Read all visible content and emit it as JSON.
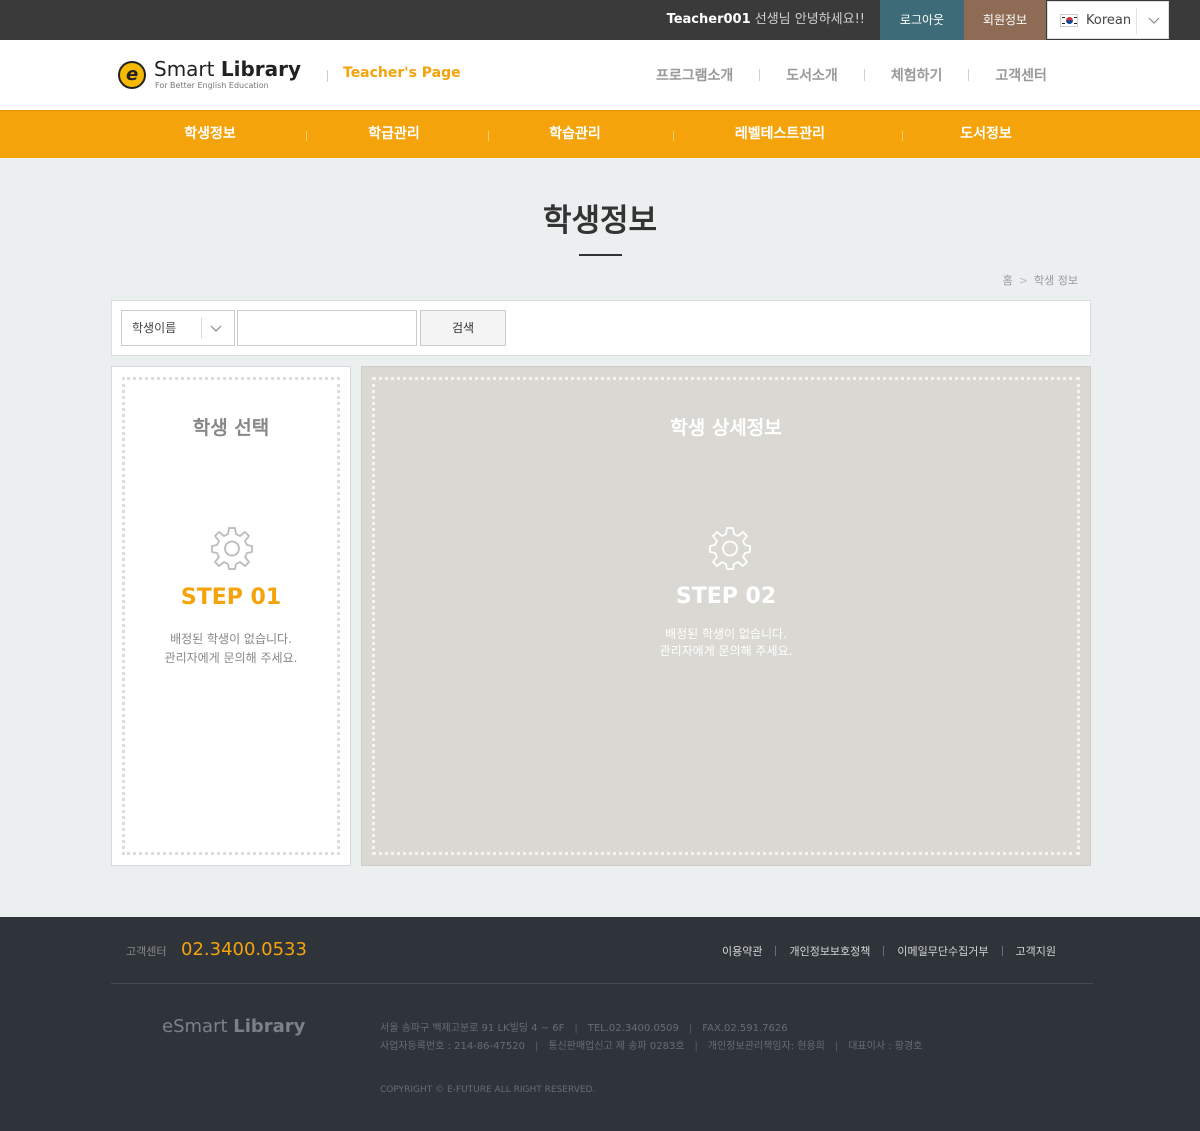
{
  "topbar": {
    "user_id": "Teacher001",
    "greeting_suffix": " 선생님 안녕하세요!!",
    "logout_label": "로그아웃",
    "member_info_label": "회원정보",
    "language": "Korean"
  },
  "header": {
    "logo_text_light": "Smart ",
    "logo_text_bold": "Library",
    "logo_mark": "e",
    "logo_tagline": "For Better English Education",
    "section_label": "Teacher's Page",
    "gnb": [
      "프로그램소개",
      "도서소개",
      "체험하기",
      "고객센터"
    ]
  },
  "mainnav": {
    "items": [
      "학생정보",
      "학급관리",
      "학습관리",
      "레벨테스트관리",
      "도서정보"
    ]
  },
  "page": {
    "title": "학생정보",
    "breadcrumb_home": "홈",
    "breadcrumb_arrow": ">",
    "breadcrumb_current": "학생 정보"
  },
  "search": {
    "select_value": "학생이름",
    "input_value": "",
    "button_label": "검색"
  },
  "panels": {
    "left": {
      "title": "학생 선택",
      "step": "STEP 01",
      "message_line1": "배정된 학생이 없습니다.",
      "message_line2": "관리자에게 문의해 주세요."
    },
    "right": {
      "title": "학생 상세정보",
      "step": "STEP 02",
      "message_line1": "배정된 학생이 없습니다.",
      "message_line2": "관리자에게 문의해 주세요."
    }
  },
  "footer": {
    "cs_label": "고객센터",
    "cs_phone": "02.3400.0533",
    "links": [
      "이용약관",
      "개인정보보호정책",
      "이메일무단수집거부",
      "고객지원"
    ],
    "logo_light": "eSmart ",
    "logo_bold": "Library",
    "address": "서울 송파구 백제고분로 91 LK빌딩 4 ~ 6F",
    "tel": "TEL.02.3400.0509",
    "fax": "FAX.02.591.7626",
    "biz_no": "사업자등록번호 : 214-86-47520",
    "mail_order_no": "통신판매업신고 제 송파 0283호",
    "privacy_officer": "개인정보관리책임자: 현용희",
    "ceo": "대표이사 : 황경호",
    "copyright": "COPYRIGHT © E-FUTURE ALL RIGHT RESERVED."
  },
  "colors": {
    "accent": "#f5a30b",
    "topbar": "#3a3a3a",
    "logout": "#3d6b78",
    "member": "#8d6b55",
    "footer": "#2f343b"
  }
}
